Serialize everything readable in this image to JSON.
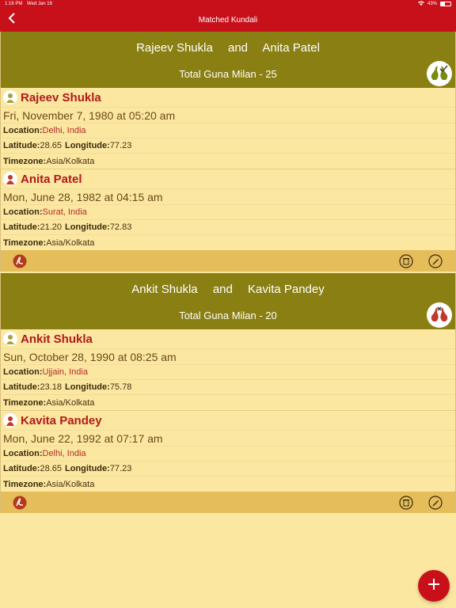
{
  "status": {
    "time": "1:16 PM",
    "date": "Wed Jan 16",
    "battery": "43%"
  },
  "nav": {
    "title": "Matched Kundali"
  },
  "matches": [
    {
      "name1": "Rajeev Shukla",
      "and": "and",
      "name2": "Anita Patel",
      "guna": "Total Guna Milan - 25",
      "person1": {
        "name": "Rajeev Shukla",
        "datetime": "Fri, November 7, 1980 at 05:20 am",
        "location_label": "Location:",
        "location": "Delhi, India",
        "latitude_label": "Latitude:",
        "latitude": "28.65",
        "longitude_label": "Longitude:",
        "longitude": "77.23",
        "timezone_label": "Timezone:",
        "timezone": "Asia/Kolkata"
      },
      "person2": {
        "name": "Anita Patel",
        "datetime": "Mon, June 28, 1982 at 04:15 am",
        "location_label": "Location:",
        "location": "Surat, India",
        "latitude_label": "Latitude:",
        "latitude": "21.20",
        "longitude_label": "Longitude:",
        "longitude": "72.83",
        "timezone_label": "Timezone:",
        "timezone": "Asia/Kolkata"
      }
    },
    {
      "name1": "Ankit Shukla",
      "and": "and",
      "name2": "Kavita Pandey",
      "guna": "Total Guna Milan - 20",
      "person1": {
        "name": "Ankit Shukla",
        "datetime": "Sun, October 28, 1990 at 08:25 am",
        "location_label": "Location:",
        "location": "Ujjain, India",
        "latitude_label": "Latitude:",
        "latitude": "23.18",
        "longitude_label": "Longitude:",
        "longitude": "75.78",
        "timezone_label": "Timezone:",
        "timezone": "Asia/Kolkata"
      },
      "person2": {
        "name": "Kavita Pandey",
        "datetime": "Mon, June 22, 1992 at 07:17 am",
        "location_label": "Location:",
        "location": "Delhi, India",
        "latitude_label": "Latitude:",
        "latitude": "28.65",
        "longitude_label": "Longitude:",
        "longitude": "77.23",
        "timezone_label": "Timezone:",
        "timezone": "Asia/Kolkata"
      }
    }
  ],
  "icons": {
    "back": "chevron-left-icon",
    "match_good": "swans-check-icon",
    "match_bad": "swans-cross-icon",
    "male": "male-avatar-icon",
    "female": "female-avatar-icon",
    "pdf": "pdf-icon",
    "delete": "trash-icon",
    "edit": "pencil-icon",
    "add": "plus-icon"
  },
  "colors": {
    "primary": "#c8101b",
    "header": "#8a7f13",
    "background": "#fbe7a0",
    "action_bar": "#e5bd5a",
    "name_text": "#b01a1a"
  }
}
